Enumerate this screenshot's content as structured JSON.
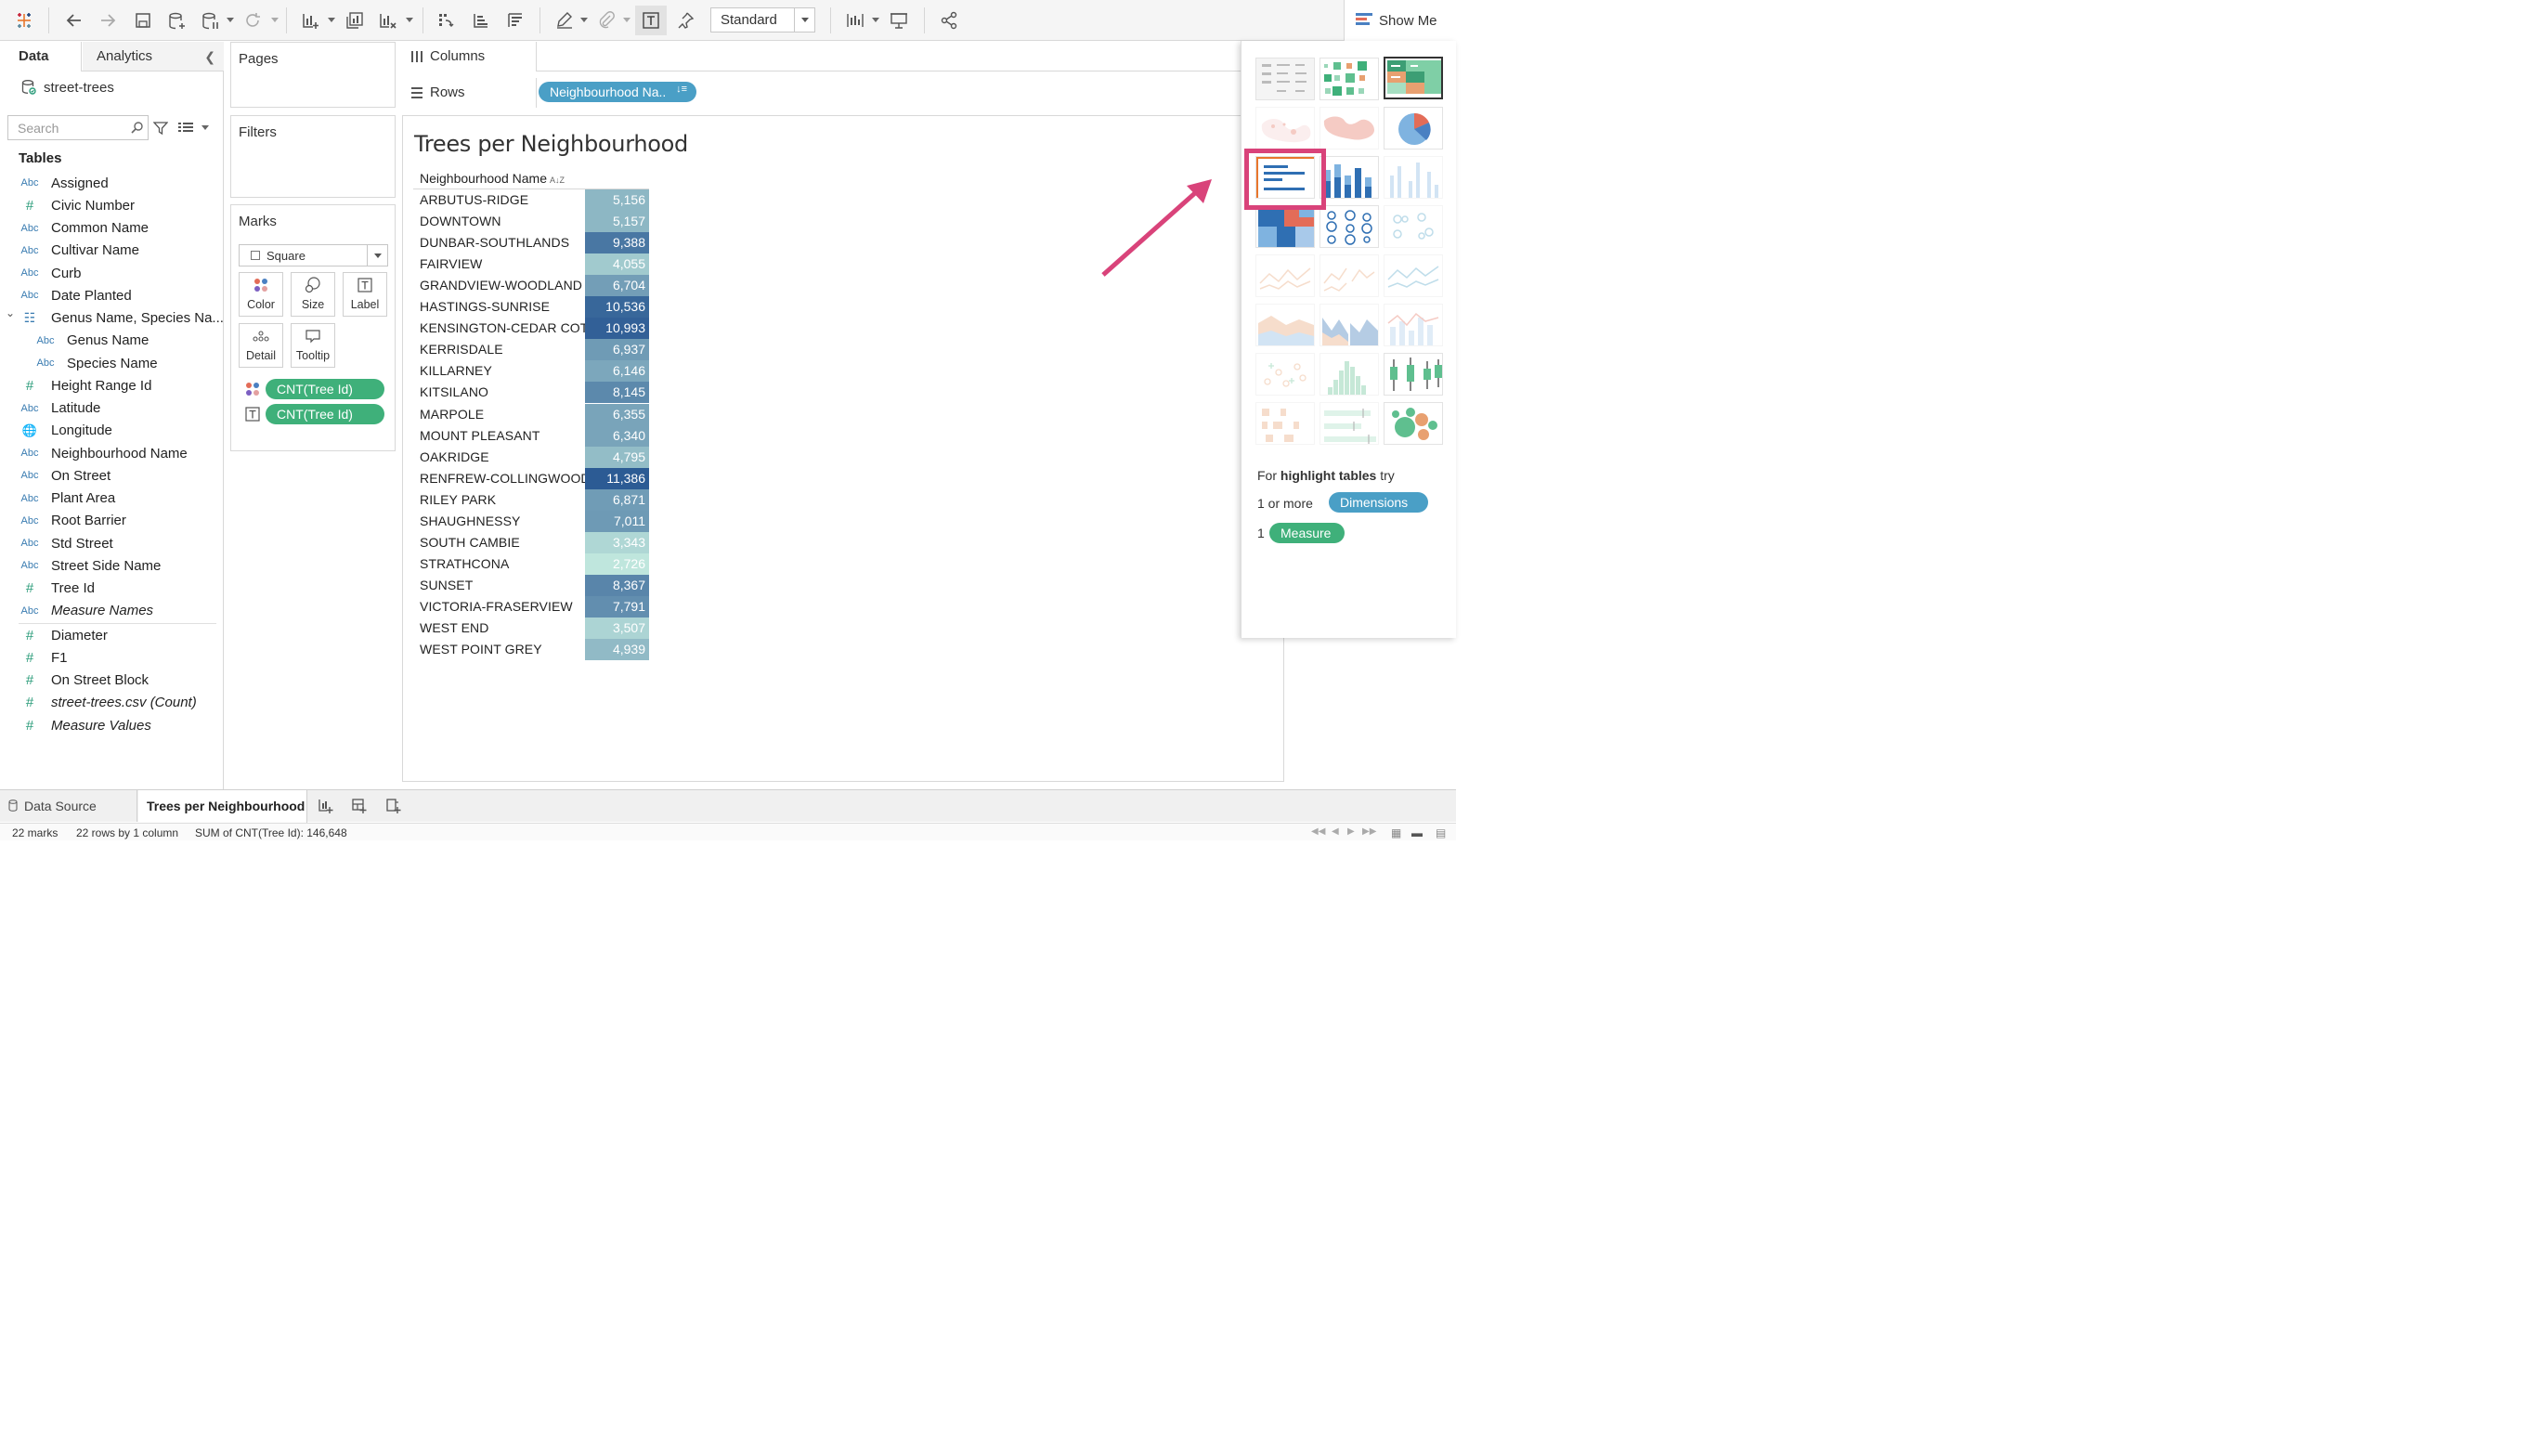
{
  "toolbar": {
    "view_mode": "Standard",
    "show_me_label": "Show Me",
    "icons": [
      "tableau-logo-icon",
      "back-icon",
      "forward-icon",
      "save-icon",
      "new-datasource-icon",
      "pause-updates-icon",
      "refresh-icon",
      "new-worksheet-icon",
      "duplicate-icon",
      "clear-sheet-icon",
      "swap-rows-columns-icon",
      "sort-ascending-icon",
      "sort-descending-icon",
      "highlight-icon",
      "group-icon",
      "show-labels-icon",
      "pin-icon",
      "fit-icon",
      "presentation-icon",
      "share-icon"
    ]
  },
  "data_pane": {
    "tab_data": "Data",
    "tab_analytics": "Analytics",
    "datasource": "street-trees",
    "search_placeholder": "Search",
    "tables_header": "Tables",
    "fields": [
      {
        "type": "Abc",
        "label": "Assigned"
      },
      {
        "type": "#",
        "label": "Civic Number"
      },
      {
        "type": "Abc",
        "label": "Common Name"
      },
      {
        "type": "Abc",
        "label": "Cultivar Name"
      },
      {
        "type": "Abc",
        "label": "Curb"
      },
      {
        "type": "Abc",
        "label": "Date Planted"
      },
      {
        "type": "hier",
        "label": "Genus Name, Species Na..."
      },
      {
        "type": "Abc",
        "label": "Genus Name"
      },
      {
        "type": "Abc",
        "label": "Species Name"
      },
      {
        "type": "#",
        "label": "Height Range Id"
      },
      {
        "type": "Abc",
        "label": "Latitude"
      },
      {
        "type": "geo",
        "label": "Longitude"
      },
      {
        "type": "Abc",
        "label": "Neighbourhood Name"
      },
      {
        "type": "Abc",
        "label": "On Street"
      },
      {
        "type": "Abc",
        "label": "Plant Area"
      },
      {
        "type": "Abc",
        "label": "Root Barrier"
      },
      {
        "type": "Abc",
        "label": "Std Street"
      },
      {
        "type": "Abc",
        "label": "Street Side Name"
      },
      {
        "type": "#",
        "label": "Tree Id"
      },
      {
        "type": "Abc",
        "label": "Measure Names"
      }
    ],
    "measures": [
      {
        "type": "#",
        "label": "Diameter"
      },
      {
        "type": "#",
        "label": "F1"
      },
      {
        "type": "#",
        "label": "On Street Block"
      },
      {
        "type": "#",
        "label": "street-trees.csv (Count)"
      },
      {
        "type": "#",
        "label": "Measure Values"
      }
    ]
  },
  "shelves": {
    "pages": "Pages",
    "filters": "Filters",
    "marks": "Marks",
    "mark_type": "Square",
    "mark_buttons": [
      "Color",
      "Size",
      "Label",
      "Detail",
      "Tooltip"
    ],
    "mark_pills": [
      "CNT(Tree Id)",
      "CNT(Tree Id)"
    ],
    "columns": "Columns",
    "rows": "Rows",
    "rows_pill": "Neighbourhood Na.."
  },
  "viz": {
    "title": "Trees per Neighbourhood",
    "header": "Neighbourhood Name"
  },
  "chart_data": {
    "type": "table",
    "title": "Trees per Neighbourhood",
    "columns": [
      "Neighbourhood Name",
      "CNT(Tree Id)"
    ],
    "categories": [
      "ARBUTUS-RIDGE",
      "DOWNTOWN",
      "DUNBAR-SOUTHLANDS",
      "FAIRVIEW",
      "GRANDVIEW-WOODLAND",
      "HASTINGS-SUNRISE",
      "KENSINGTON-CEDAR COT..",
      "KERRISDALE",
      "KILLARNEY",
      "KITSILANO",
      "MARPOLE",
      "MOUNT PLEASANT",
      "OAKRIDGE",
      "RENFREW-COLLINGWOOD",
      "RILEY PARK",
      "SHAUGHNESSY",
      "SOUTH CAMBIE",
      "STRATHCONA",
      "SUNSET",
      "VICTORIA-FRASERVIEW",
      "WEST END",
      "WEST POINT GREY"
    ],
    "values": [
      5156,
      5157,
      9388,
      4055,
      6704,
      10536,
      10993,
      6937,
      6146,
      8145,
      6355,
      6340,
      4795,
      11386,
      6871,
      7011,
      3343,
      2726,
      8367,
      7791,
      3507,
      4939
    ],
    "value_labels": [
      "5,156",
      "5,157",
      "9,388",
      "4,055",
      "6,704",
      "10,536",
      "10,993",
      "6,937",
      "6,146",
      "8,145",
      "6,355",
      "6,340",
      "4,795",
      "11,386",
      "6,871",
      "7,011",
      "3,343",
      "2,726",
      "8,367",
      "7,791",
      "3,507",
      "4,939"
    ],
    "color_scale": {
      "low": "#bfe6dd",
      "high": "#2c5b94",
      "min": 2726,
      "max": 11386
    }
  },
  "show_me": {
    "hint_prefix": "For",
    "hint_bold": "highlight tables",
    "hint_suffix": "try",
    "dims_prefix": "1 or more",
    "dims_pill": "Dimensions",
    "meas_prefix": "1",
    "meas_pill": "Measure"
  },
  "bottom": {
    "datasource_tab": "Data Source",
    "sheet_tab": "Trees per Neighbourhood",
    "status_marks": "22 marks",
    "status_rows": "22 rows by 1 column",
    "status_sum": "SUM of CNT(Tree Id): 146,648"
  },
  "colors": {
    "accent_pink": "#d9437a",
    "pill_green": "#3fb07a",
    "pill_blue": "#4a9fc6"
  }
}
